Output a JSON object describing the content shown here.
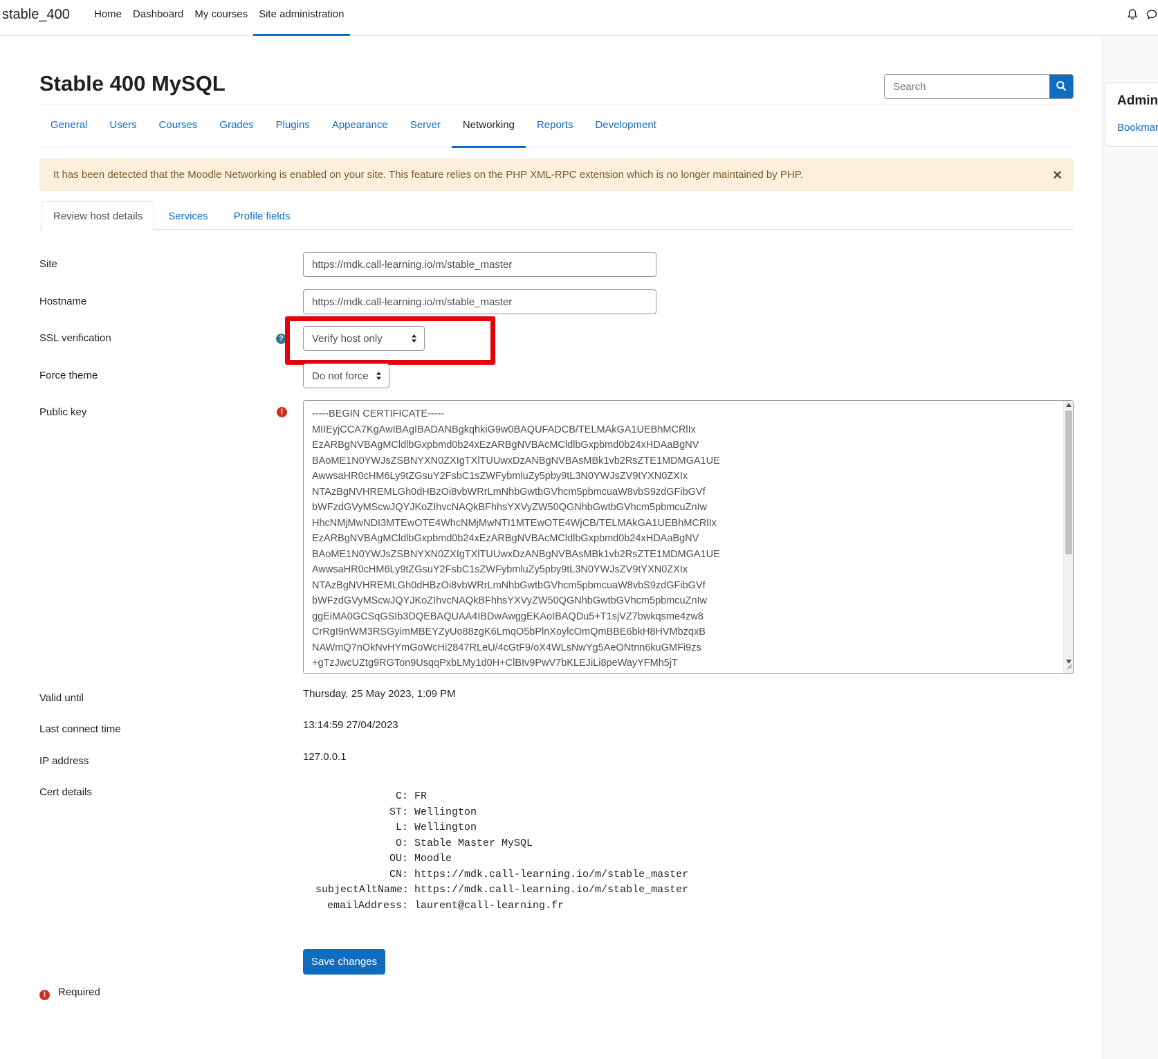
{
  "navbar": {
    "brand": "stable_400",
    "items": [
      {
        "label": "Home"
      },
      {
        "label": "Dashboard"
      },
      {
        "label": "My courses"
      },
      {
        "label": "Site administration",
        "active": true
      }
    ],
    "icons": [
      "bell-icon",
      "chat-bubble-icon"
    ]
  },
  "drawer": {
    "title": "Admin",
    "link": "Bookmar"
  },
  "header": {
    "title": "Stable 400 MySQL",
    "search_placeholder": "Search"
  },
  "secondary_nav": [
    {
      "label": "General"
    },
    {
      "label": "Users"
    },
    {
      "label": "Courses"
    },
    {
      "label": "Grades"
    },
    {
      "label": "Plugins"
    },
    {
      "label": "Appearance"
    },
    {
      "label": "Server"
    },
    {
      "label": "Networking",
      "active": true
    },
    {
      "label": "Reports"
    },
    {
      "label": "Development"
    }
  ],
  "alert": {
    "text": "It has been detected that the Moodle Networking is enabled on your site. This feature relies on the PHP XML-RPC extension which is no longer maintained by PHP.",
    "close": "×"
  },
  "form_tabs": [
    {
      "label": "Review host details",
      "active": true
    },
    {
      "label": "Services"
    },
    {
      "label": "Profile fields"
    }
  ],
  "form": {
    "site": {
      "label": "Site",
      "value": "https://mdk.call-learning.io/m/stable_master"
    },
    "hostname": {
      "label": "Hostname",
      "value": "https://mdk.call-learning.io/m/stable_master"
    },
    "ssl": {
      "label": "SSL verification",
      "value": "Verify host only",
      "help": "?"
    },
    "theme": {
      "label": "Force theme",
      "value": "Do not force"
    },
    "public_key": {
      "label": "Public key",
      "required": "!",
      "value": "-----BEGIN CERTIFICATE-----\nMIIEyjCCA7KgAwIBAgIBADANBgkqhkiG9w0BAQUFADCB/TELMAkGA1UEBhMCRlIx\nEzARBgNVBAgMCldlbGxpbmd0b24xEzARBgNVBAcMCldlbGxpbmd0b24xHDAaBgNV\nBAoME1N0YWJsZSBNYXN0ZXIgTXlTUUwxDzANBgNVBAsMBk1vb2RsZTE1MDMGA1UE\nAwwsaHR0cHM6Ly9tZGsuY2FsbC1sZWFybmluZy5pby9tL3N0YWJsZV9tYXN0ZXIx\nNTAzBgNVHREMLGh0dHBzOi8vbWRrLmNhbGwtbGVhcm5pbmcuaW8vbS9zdGFibGVf\nbWFzdGVyMScwJQYJKoZIhvcNAQkBFhhsYXVyZW50QGNhbGwtbGVhcm5pbmcuZnIw\nHhcNMjMwNDI3MTEwOTE4WhcNMjMwNTI1MTEwOTE4WjCB/TELMAkGA1UEBhMCRlIx\nEzARBgNVBAgMCldlbGxpbmd0b24xEzARBgNVBAcMCldlbGxpbmd0b24xHDAaBgNV\nBAoME1N0YWJsZSBNYXN0ZXIgTXlTUUwxDzANBgNVBAsMBk1vb2RsZTE1MDMGA1UE\nAwwsaHR0cHM6Ly9tZGsuY2FsbC1sZWFybmluZy5pby9tL3N0YWJsZV9tYXN0ZXIx\nNTAzBgNVHREMLGh0dHBzOi8vbWRrLmNhbGwtbGVhcm5pbmcuaW8vbS9zdGFibGVf\nbWFzdGVyMScwJQYJKoZIhvcNAQkBFhhsYXVyZW50QGNhbGwtbGVhcm5pbmcuZnIw\nggEiMA0GCSqGSIb3DQEBAQUAA4IBDwAwggEKAoIBAQDu5+T1sjVZ7bwkqsme4zw8\nCrRgI9nWM3RSGyimMBEYZyUo88zgK6LmqO5bPlnXoylcOmQmBBE6bkH8HVMbzqxB\nNAWmQ7nOkNvHYmGoWcHi2847RLeU/4cGtF9/oX4WLsNwYg5AeONtnn6kuGMFi9zs\n+gTzJwcUZtg9RGTon9UsqqPxbLMy1d0H+ClBIv9PwV7bKLEJiLi8peWayYFMh5jT"
    },
    "valid_until": {
      "label": "Valid until",
      "value": "Thursday, 25 May 2023, 1:09 PM"
    },
    "last_connect": {
      "label": "Last connect time",
      "value": "13:14:59 27/04/2023"
    },
    "ip": {
      "label": "IP address",
      "value": "127.0.0.1"
    },
    "cert": {
      "label": "Cert details",
      "rows": [
        {
          "key": "C:",
          "value": "FR"
        },
        {
          "key": "ST:",
          "value": "Wellington"
        },
        {
          "key": "L:",
          "value": "Wellington"
        },
        {
          "key": "O:",
          "value": "Stable Master MySQL"
        },
        {
          "key": "OU:",
          "value": "Moodle"
        },
        {
          "key": "CN:",
          "value": "https://mdk.call-learning.io/m/stable_master"
        },
        {
          "key": "subjectAltName:",
          "value": "https://mdk.call-learning.io/m/stable_master"
        },
        {
          "key": "emailAddress:",
          "value": "laurent@call-learning.fr"
        }
      ]
    },
    "save_label": "Save changes",
    "required_note": "Required",
    "required_icon": "!"
  },
  "colors": {
    "primary": "#0f6cbf",
    "danger": "#ca3120",
    "highlight": "#e5000a",
    "alert_bg": "#fcefdc"
  }
}
